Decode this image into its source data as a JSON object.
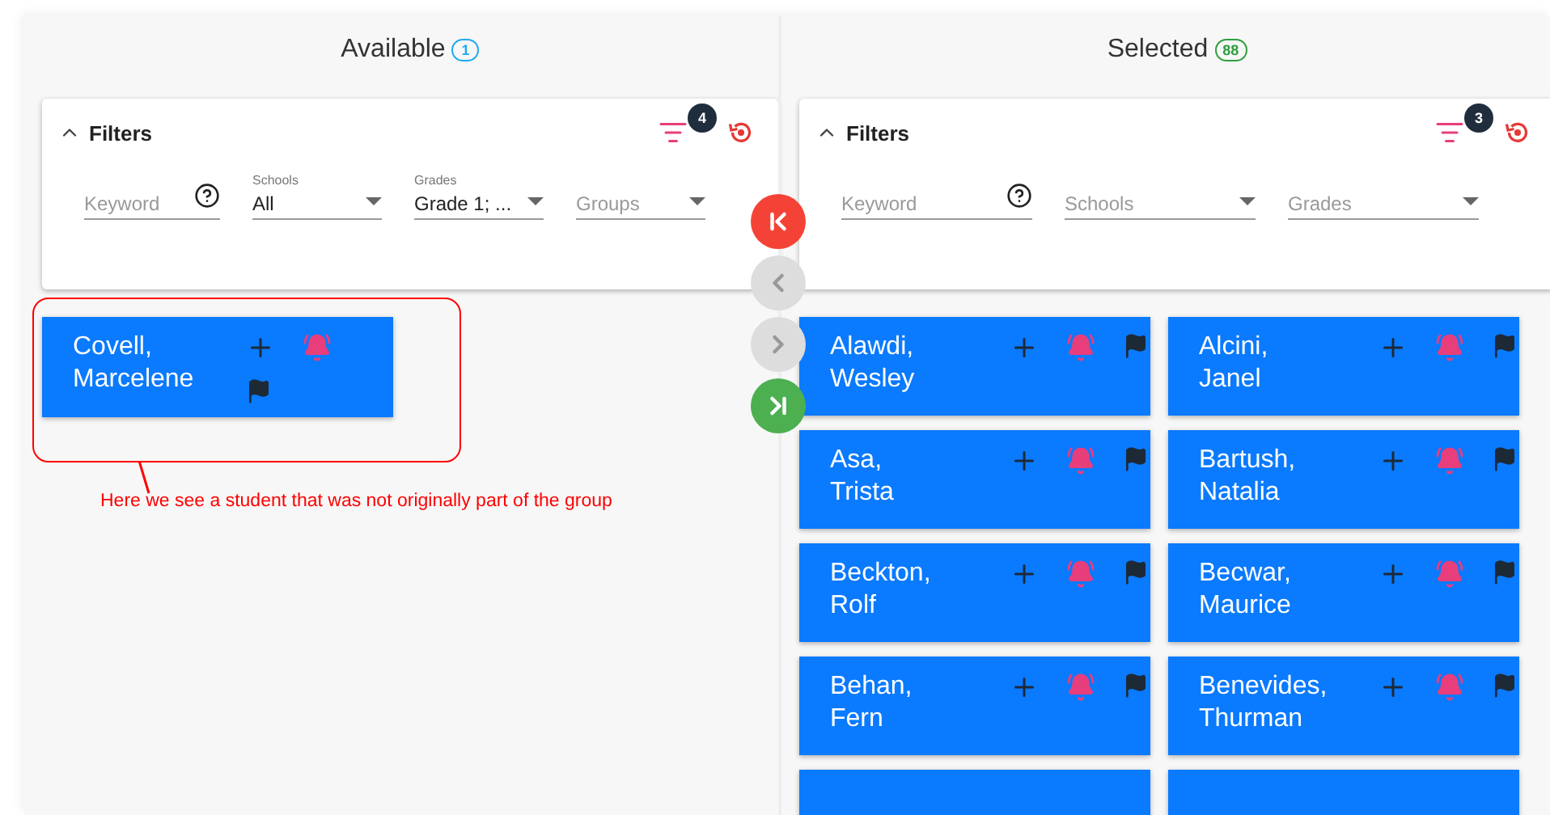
{
  "panels": [
    {
      "title": "Available",
      "count": {
        "text": "1",
        "color": "#1eaaf1"
      },
      "filters": {
        "title": "Filters",
        "expanded": true,
        "active_count": "4",
        "fields": [
          {
            "kind": "keyword",
            "placeholder": "Keyword"
          },
          {
            "kind": "select",
            "label": "Schools",
            "value": "All"
          },
          {
            "kind": "select",
            "label": "Grades",
            "value": "Grade 1; ..."
          },
          {
            "kind": "select",
            "placeholder": "Groups"
          }
        ]
      },
      "students": [
        {
          "name": "Covell, Marcelene"
        }
      ]
    },
    {
      "title": "Selected",
      "count": {
        "text": "88",
        "color": "#2e9e3e"
      },
      "filters": {
        "title": "Filters",
        "expanded": true,
        "active_count": "3",
        "fields": [
          {
            "kind": "keyword",
            "placeholder": "Keyword"
          },
          {
            "kind": "select",
            "placeholder": "Schools"
          },
          {
            "kind": "select",
            "placeholder": "Grades"
          }
        ]
      },
      "students": [
        {
          "name": "Alawdi, Wesley"
        },
        {
          "name": "Alcini, Janel"
        },
        {
          "name": "Asa, Trista"
        },
        {
          "name": "Bartush, Natalia"
        },
        {
          "name": "Beckton, Rolf"
        },
        {
          "name": "Becwar, Maurice"
        },
        {
          "name": "Behan, Fern"
        },
        {
          "name": "Benevides, Thurman"
        },
        {
          "kind": "cut_off"
        },
        {
          "kind": "cut_off"
        }
      ]
    }
  ],
  "transfer_buttons": [
    {
      "kind": "all_left",
      "disabled": false
    },
    {
      "kind": "left",
      "disabled": true
    },
    {
      "kind": "right",
      "disabled": true
    },
    {
      "kind": "all_right",
      "disabled": false
    }
  ],
  "annotation": {
    "text": "Here we see a student that was not originally part of the group"
  }
}
